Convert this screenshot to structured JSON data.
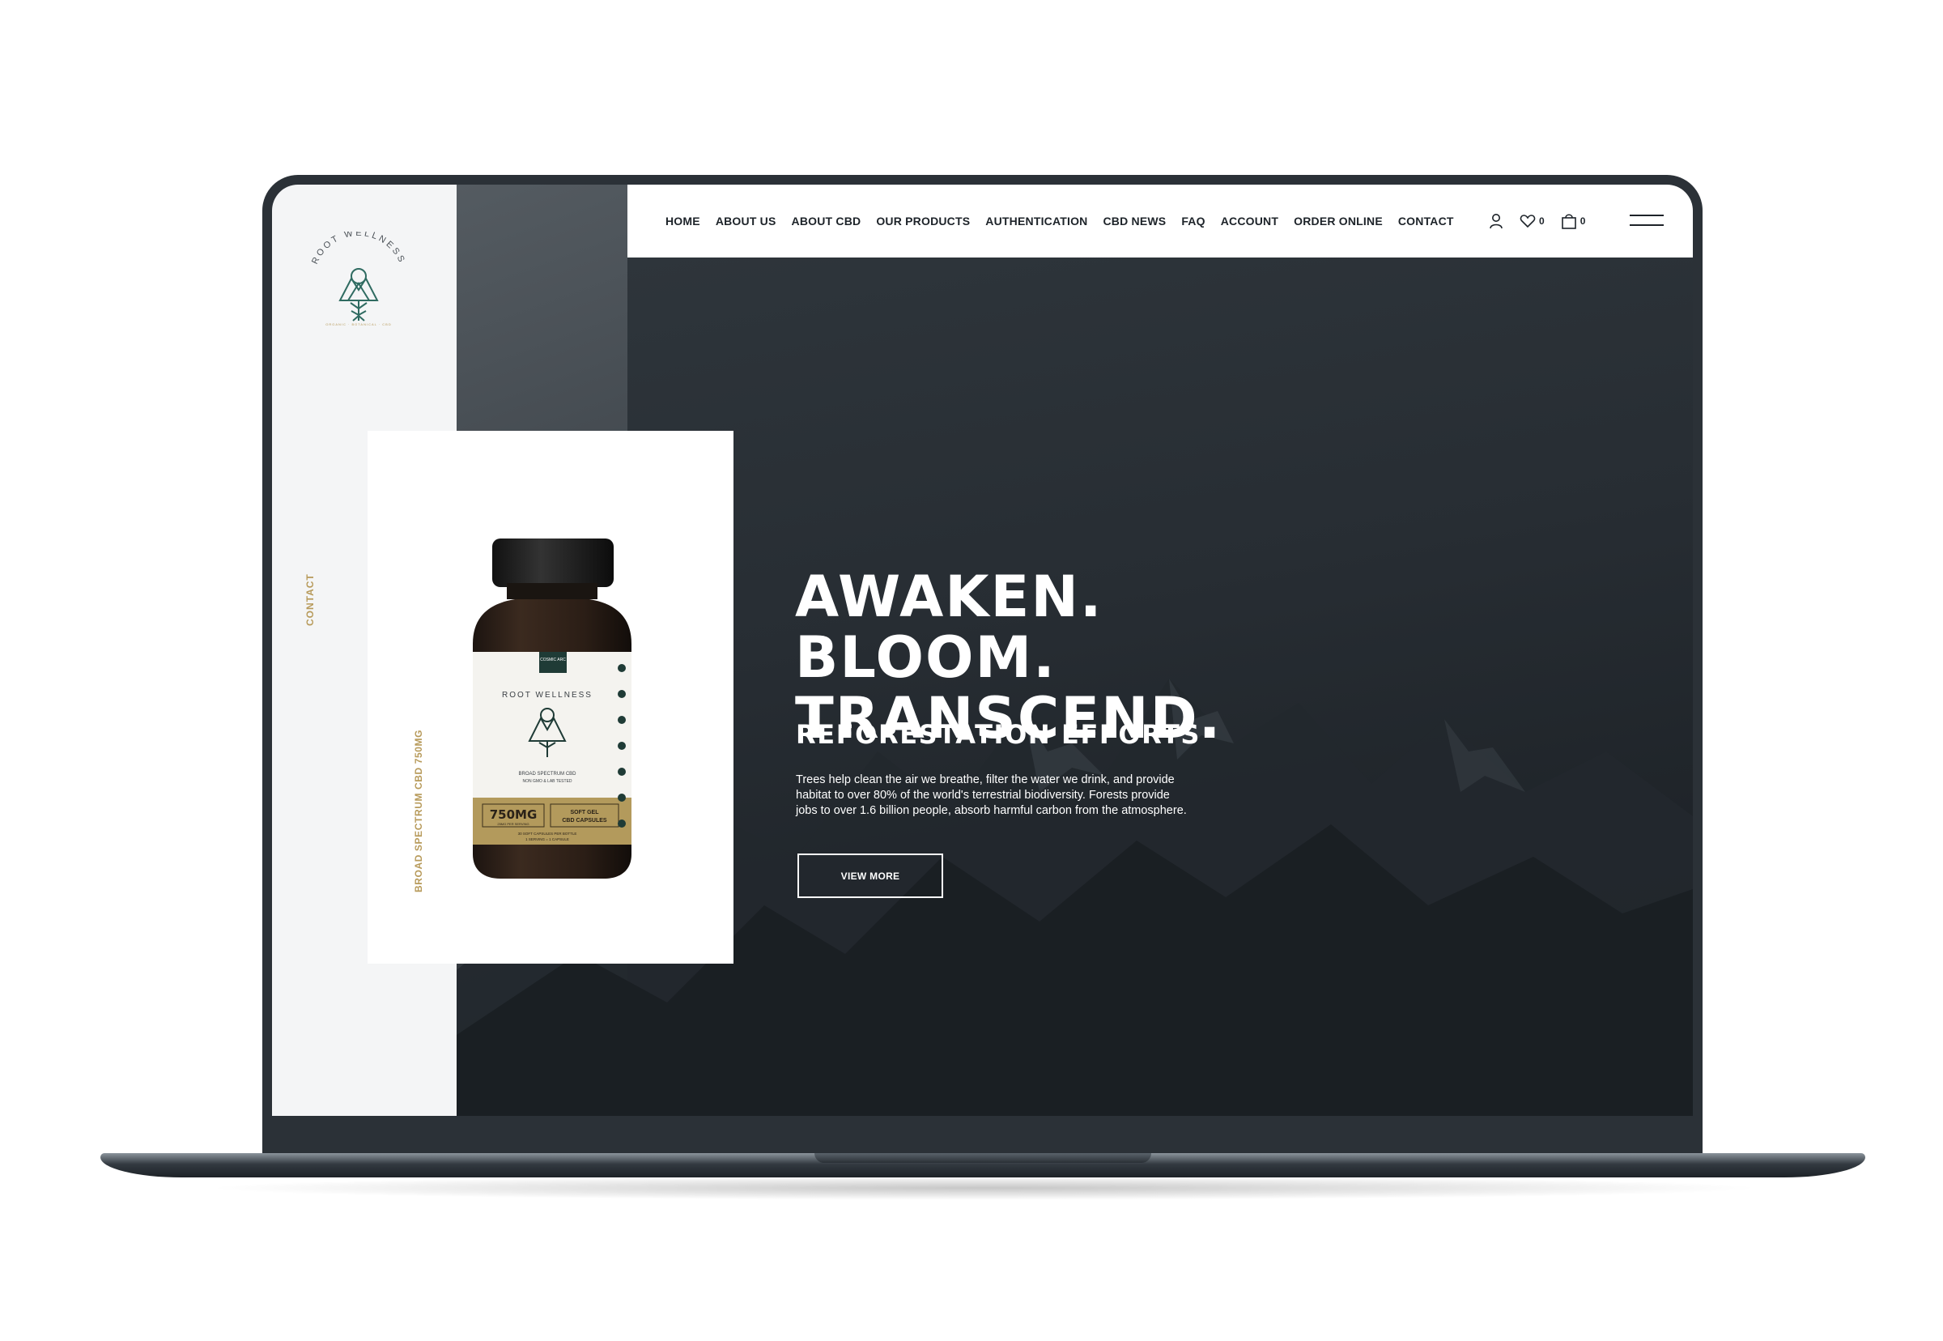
{
  "brand": {
    "name": "ROOT WELLNESS",
    "tagline": "ORGANIC · BOTANICAL · CBD",
    "gold": "#b79a5a",
    "teal": "#2f6b61",
    "dark": "#1d2329"
  },
  "nav": {
    "items": [
      {
        "label": "HOME"
      },
      {
        "label": "ABOUT US"
      },
      {
        "label": "ABOUT CBD"
      },
      {
        "label": "OUR PRODUCTS"
      },
      {
        "label": "AUTHENTICATION"
      },
      {
        "label": "CBD NEWS"
      },
      {
        "label": "FAQ"
      },
      {
        "label": "ACCOUNT"
      },
      {
        "label": "ORDER ONLINE"
      },
      {
        "label": "CONTACT"
      }
    ],
    "wishlist_count": "0",
    "cart_count": "0",
    "icons": [
      "user-icon",
      "heart-icon",
      "cart-icon",
      "hamburger-menu-icon"
    ]
  },
  "sidebar": {
    "contact_label": "CONTACT"
  },
  "product": {
    "vertical_label": "BROAD SPECTRUM CBD 750MG",
    "label_badge": "COSMIC ARC",
    "label_brand": "ROOT WELLNESS",
    "label_line1": "BROAD SPECTRUM CBD",
    "label_line2": "NON GMO & LAB TESTED",
    "dose": "750MG",
    "dose_sub": "25MG PER SERVING",
    "type_line1": "SOFT GEL",
    "type_line2": "CBD CAPSULES",
    "count_line": "30 SOFT CAPSULES PER BOTTLE",
    "serving_line": "1 SERVING = 1 CAPSULE"
  },
  "hero": {
    "title_line1": "AWAKEN. BLOOM.",
    "title_line2": "TRANSCEND.",
    "subtitle": "REFORESTATION EFFORTS",
    "body_line1": "Trees help clean the air we breathe, filter the water we drink, and provide",
    "body_line2": "habitat to over 80% of the world's terrestrial biodiversity. Forests provide",
    "body_line3": "jobs to over 1.6 billion people, absorb harmful carbon from the  atmosphere.",
    "button_label": "VIEW MORE"
  }
}
